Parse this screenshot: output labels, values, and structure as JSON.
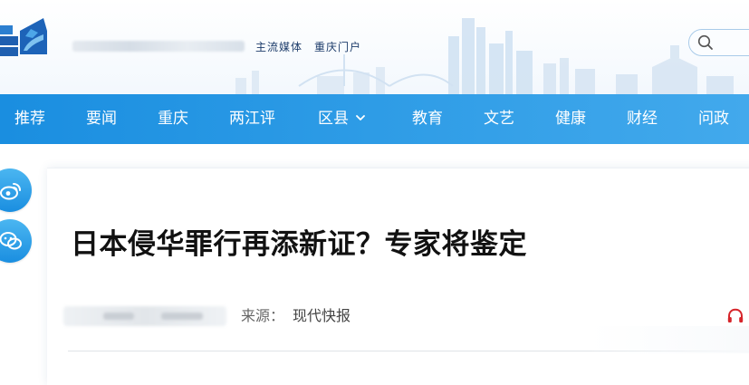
{
  "header": {
    "tagline_blurred": "",
    "slogan": "主流媒体　重庆门户",
    "search": {
      "placeholder": ""
    }
  },
  "nav": {
    "items": [
      {
        "label": "推荐"
      },
      {
        "label": "要闻"
      },
      {
        "label": "重庆"
      },
      {
        "label": "两江评"
      },
      {
        "label": "区县"
      },
      {
        "label": "教育"
      },
      {
        "label": "文艺"
      },
      {
        "label": "健康"
      },
      {
        "label": "财经"
      },
      {
        "label": "问政"
      }
    ]
  },
  "article": {
    "title": "日本侵华罪行再添新证？专家将鉴定",
    "source_label": "来源：",
    "source_value": "现代快报"
  },
  "colors": {
    "nav_bg": "#1a8ee0",
    "nav_text": "#ffffff",
    "title_text": "#111111",
    "audio_icon": "#d6242a"
  },
  "icons": [
    "logo-icon",
    "search-icon",
    "chevron-down-icon",
    "weibo-icon",
    "wechat-icon",
    "audio-icon"
  ]
}
